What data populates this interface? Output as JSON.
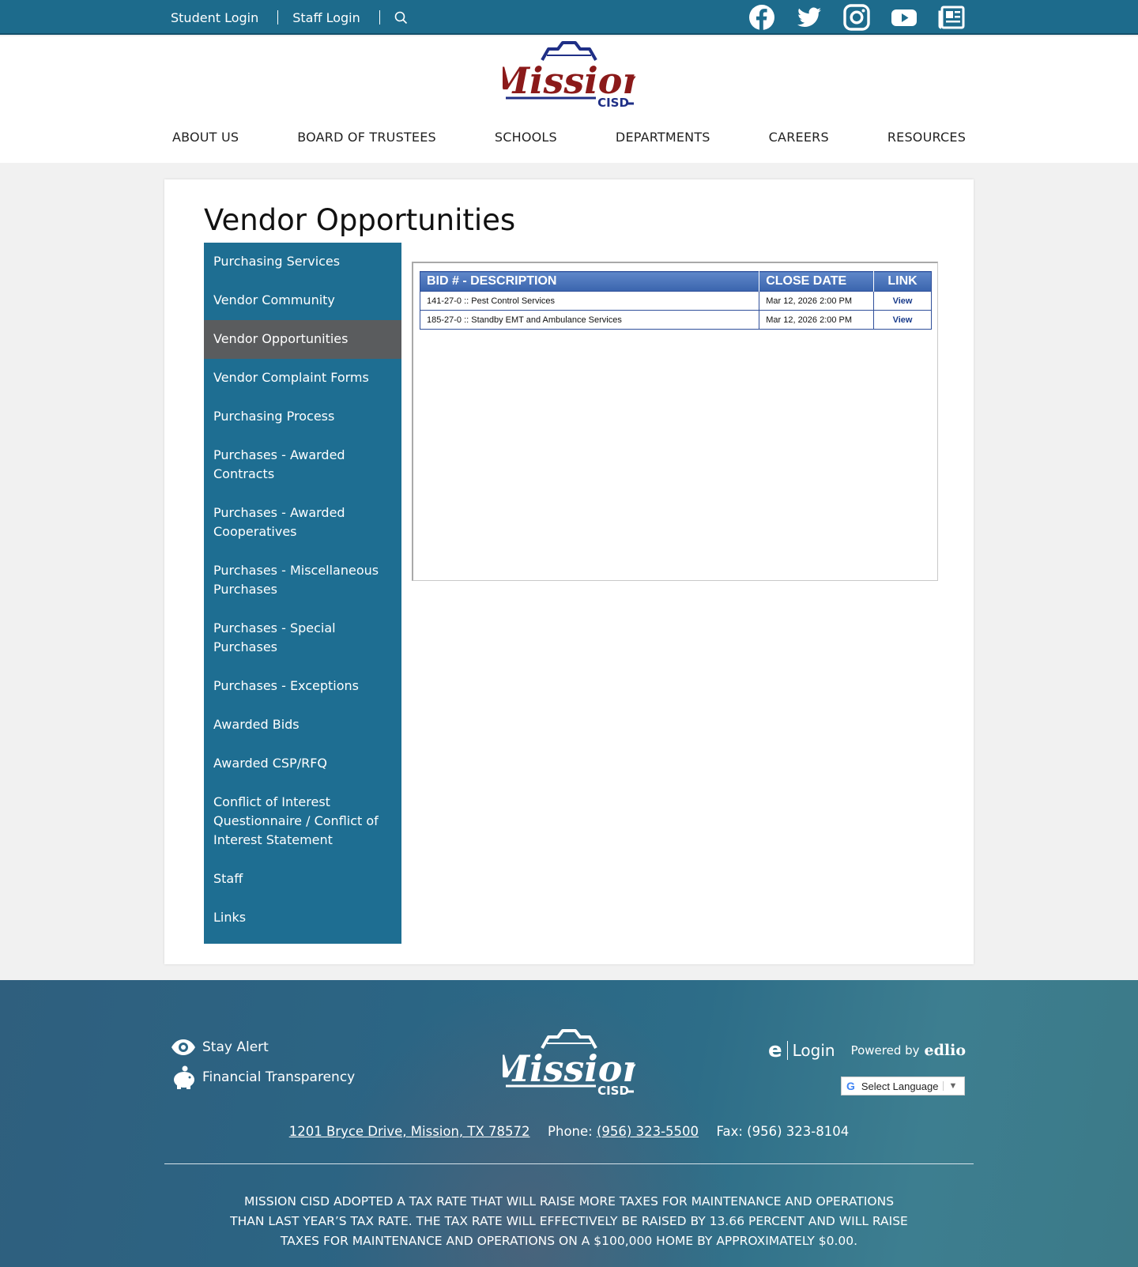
{
  "topbar": {
    "student_login": "Student Login",
    "staff_login": "Staff Login",
    "search_icon": "search-icon",
    "social_icons": [
      "facebook-icon",
      "twitter-icon",
      "instagram-icon",
      "youtube-icon",
      "newspaper-icon"
    ]
  },
  "header": {
    "logo_text": "Mission",
    "logo_subtext": "CISD",
    "nav": [
      "ABOUT US",
      "BOARD OF TRUSTEES",
      "SCHOOLS",
      "DEPARTMENTS",
      "CAREERS",
      "RESOURCES"
    ]
  },
  "main": {
    "title": "Vendor Opportunities",
    "sidenav": [
      {
        "label": "Purchasing Services"
      },
      {
        "label": "Vendor Community"
      },
      {
        "label": "Vendor Opportunities",
        "active": true
      },
      {
        "label": "Vendor Complaint Forms"
      },
      {
        "label": "Purchasing Process"
      },
      {
        "label": "Purchases - Awarded Contracts"
      },
      {
        "label": "Purchases - Awarded Cooperatives"
      },
      {
        "label": "Purchases - Miscellaneous Purchases"
      },
      {
        "label": "Purchases - Special Purchases"
      },
      {
        "label": "Purchases - Exceptions"
      },
      {
        "label": "Awarded Bids"
      },
      {
        "label": "Awarded CSP/RFQ"
      },
      {
        "label": "Conflict of Interest Questionnaire / Conflict of Interest Statement"
      },
      {
        "label": "Staff"
      },
      {
        "label": "Links"
      }
    ],
    "table": {
      "headers": [
        "BID # - DESCRIPTION",
        "CLOSE DATE",
        "LINK"
      ],
      "rows": [
        {
          "description": "141-27-0 :: Pest Control Services",
          "close_date": "Mar 12, 2026 2:00 PM",
          "link": "View"
        },
        {
          "description": "185-27-0 :: Standby EMT and Ambulance Services",
          "close_date": "Mar 12, 2026 2:00 PM",
          "link": "View"
        }
      ]
    }
  },
  "footer": {
    "links": [
      {
        "label": "Stay Alert",
        "icon": "eye-icon"
      },
      {
        "label": "Financial Transparency",
        "icon": "piggy-bank-icon"
      }
    ],
    "logo_text": "Mission",
    "logo_subtext": "CISD",
    "edlio_e": "e",
    "login": "Login",
    "powered_by": "Powered by",
    "edlio": "edlio",
    "language_label": "Select Language",
    "address": "1201 Bryce Drive, Mission, TX 78572",
    "phone_label": "Phone:",
    "phone": "(956) 323-5500",
    "fax": "Fax: (956) 323-8104",
    "tax_notice": "MISSION CISD ADOPTED A TAX RATE THAT WILL RAISE MORE TAXES FOR MAINTENANCE AND OPERATIONS THAN LAST YEAR’S TAX RATE. THE TAX RATE WILL EFFECTIVELY BE RAISED BY 13.66 PERCENT AND WILL RAISE TAXES FOR MAINTENANCE AND OPERATIONS ON A $100,000 HOME BY APPROXIMATELY $0.00."
  },
  "colors": {
    "topbar": "#1d6b8c",
    "sidenav": "#1e6e92",
    "sidenav_active": "#5a5c5e",
    "logo_red": "#8b1a1a",
    "logo_blue": "#1f2f86",
    "table_header": "#3a64ad"
  }
}
